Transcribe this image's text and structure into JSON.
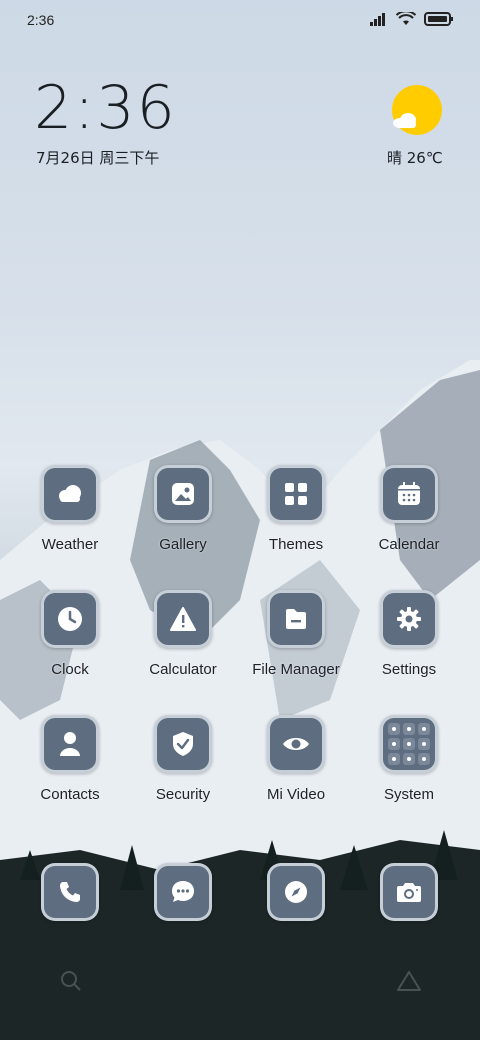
{
  "status_bar": {
    "time": "2:36",
    "icons": [
      "signal-icon",
      "wifi-icon",
      "battery-icon"
    ]
  },
  "clock_widget": {
    "time": "2:36",
    "date": "7月26日 周三下午"
  },
  "weather_widget": {
    "icon": "sunny-cloud-icon",
    "text": "晴 26℃"
  },
  "apps": [
    {
      "label": "Weather",
      "icon": "weather-icon"
    },
    {
      "label": "Gallery",
      "icon": "gallery-icon"
    },
    {
      "label": "Themes",
      "icon": "themes-icon"
    },
    {
      "label": "Calendar",
      "icon": "calendar-icon"
    },
    {
      "label": "Clock",
      "icon": "clock-icon"
    },
    {
      "label": "Calculator",
      "icon": "calculator-icon"
    },
    {
      "label": "File Manager",
      "icon": "file-manager-icon"
    },
    {
      "label": "Settings",
      "icon": "settings-icon"
    },
    {
      "label": "Contacts",
      "icon": "contacts-icon"
    },
    {
      "label": "Security",
      "icon": "security-icon"
    },
    {
      "label": "Mi Video",
      "icon": "mi-video-icon"
    },
    {
      "label": "System",
      "icon": "system-folder-icon"
    }
  ],
  "dock": [
    {
      "icon": "phone-icon"
    },
    {
      "icon": "messages-icon"
    },
    {
      "icon": "browser-icon"
    },
    {
      "icon": "camera-icon"
    }
  ],
  "colors": {
    "tile": "#5e6d80",
    "tile_border": "#d2d8e0",
    "sun": "#ffcc00"
  }
}
